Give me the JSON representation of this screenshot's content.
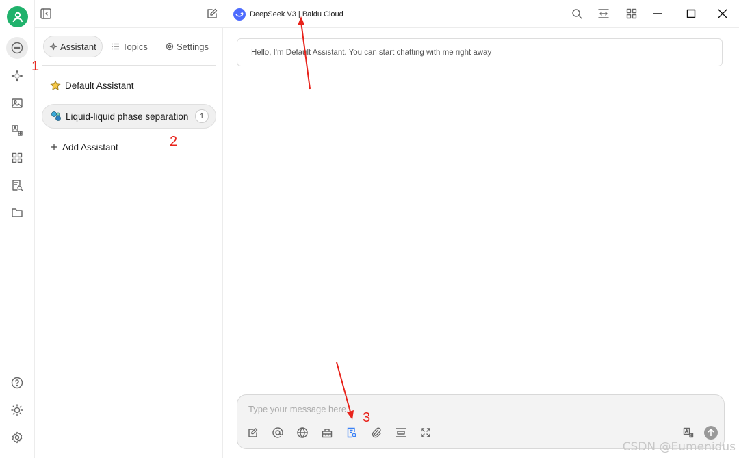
{
  "window": {
    "title_model": "DeepSeek V3 | Baidu Cloud"
  },
  "sidebar": {
    "tabs": [
      {
        "label": "Assistant"
      },
      {
        "label": "Topics"
      },
      {
        "label": "Settings"
      }
    ],
    "assistants": [
      {
        "label": "Default Assistant",
        "icon": "star-icon"
      },
      {
        "label": "Liquid-liquid phase separation",
        "icon": "molecule-icon",
        "badge": "1"
      }
    ],
    "add_label": "Add Assistant"
  },
  "chat": {
    "greeting": "Hello, I'm Default Assistant. You can start chatting with me right away",
    "input_placeholder": "Type your message here..."
  },
  "annotations": {
    "n1": "1",
    "n2": "2",
    "n3": "3"
  },
  "watermark": "CSDN @Eumenidus",
  "colors": {
    "accent": "#3b82f6",
    "avatar": "#20b26c",
    "annotation": "#e8231b"
  }
}
